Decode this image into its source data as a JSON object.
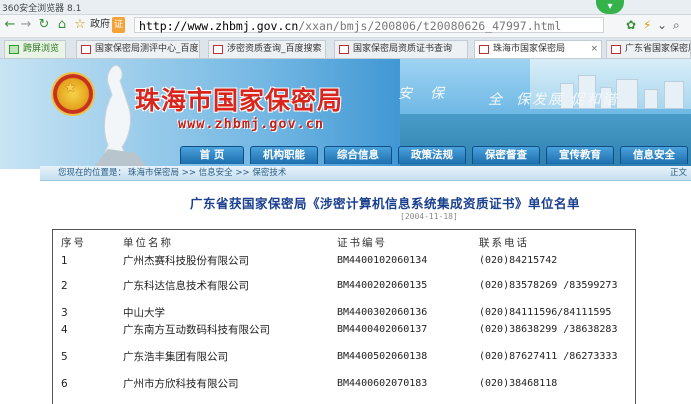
{
  "browser": {
    "title": "360安全浏览器 8.1",
    "zone_label": "政府",
    "zone_badge": "证",
    "url_host": "http://www.zhbmj.gov.cn",
    "url_path": "/xxan/bmjs/200806/t20080626_47997.html",
    "tabs": [
      {
        "label": "跨屏浏览"
      },
      {
        "label": "国家保密局测评中心_百度"
      },
      {
        "label": "涉密资质查询_百度搜索"
      },
      {
        "label": "国家保密局资质证书查询"
      },
      {
        "label": "珠海市国家保密局"
      },
      {
        "label": "广东省国家保密局网站"
      }
    ]
  },
  "site": {
    "title": "珠海市国家保密局",
    "url": "www.zhbmj.gov.cn",
    "slogan_1": "安",
    "slogan_2": "保",
    "slogan_3": "全",
    "slogan_4": "保发展 促和谐"
  },
  "nav": {
    "items": [
      {
        "label": "首 页"
      },
      {
        "label": "机构职能"
      },
      {
        "label": "综合信息"
      },
      {
        "label": "政策法规"
      },
      {
        "label": "保密督查"
      },
      {
        "label": "宣传教育"
      },
      {
        "label": "信息安全"
      }
    ]
  },
  "breadcrumb": {
    "prefix": "您现在的位置是：",
    "home": "珠海市保密局",
    "level1": "信息安全",
    "level2": "保密技术",
    "sep": " >> ",
    "right_link": "正文"
  },
  "article": {
    "title": "广东省获国家保密局《涉密计算机信息系统集成资质证书》单位名单",
    "date": "[2004-11-18]"
  },
  "table": {
    "headers": {
      "no": "序号",
      "name": "单位名称",
      "cert": "证书编号",
      "phone": "联系电话"
    },
    "rows": [
      {
        "no": "1",
        "name": "广州杰赛科技股份有限公司",
        "cert": "BM4400102060134",
        "phone": "(020)84215742"
      },
      {
        "no": "2",
        "name": "广东科达信息技术有限公司",
        "cert": "BM4400202060135",
        "phone": "(020)83578269 /83599273"
      },
      {
        "no": "3",
        "name": "中山大学",
        "cert": "BM4400302060136",
        "phone": "(020)84111596/84111595"
      },
      {
        "no": "4",
        "name": "广东南方互动数码科技有限公司",
        "cert": "BM4400402060137",
        "phone": "(020)38638299 /38638283"
      },
      {
        "no": "5",
        "name": "广东浩丰集团有限公司",
        "cert": "BM4400502060138",
        "phone": "(020)87627411 /86273333"
      },
      {
        "no": "6",
        "name": "广州市方欣科技有限公司",
        "cert": "BM4400602070183",
        "phone": "(020)38468118"
      }
    ]
  }
}
